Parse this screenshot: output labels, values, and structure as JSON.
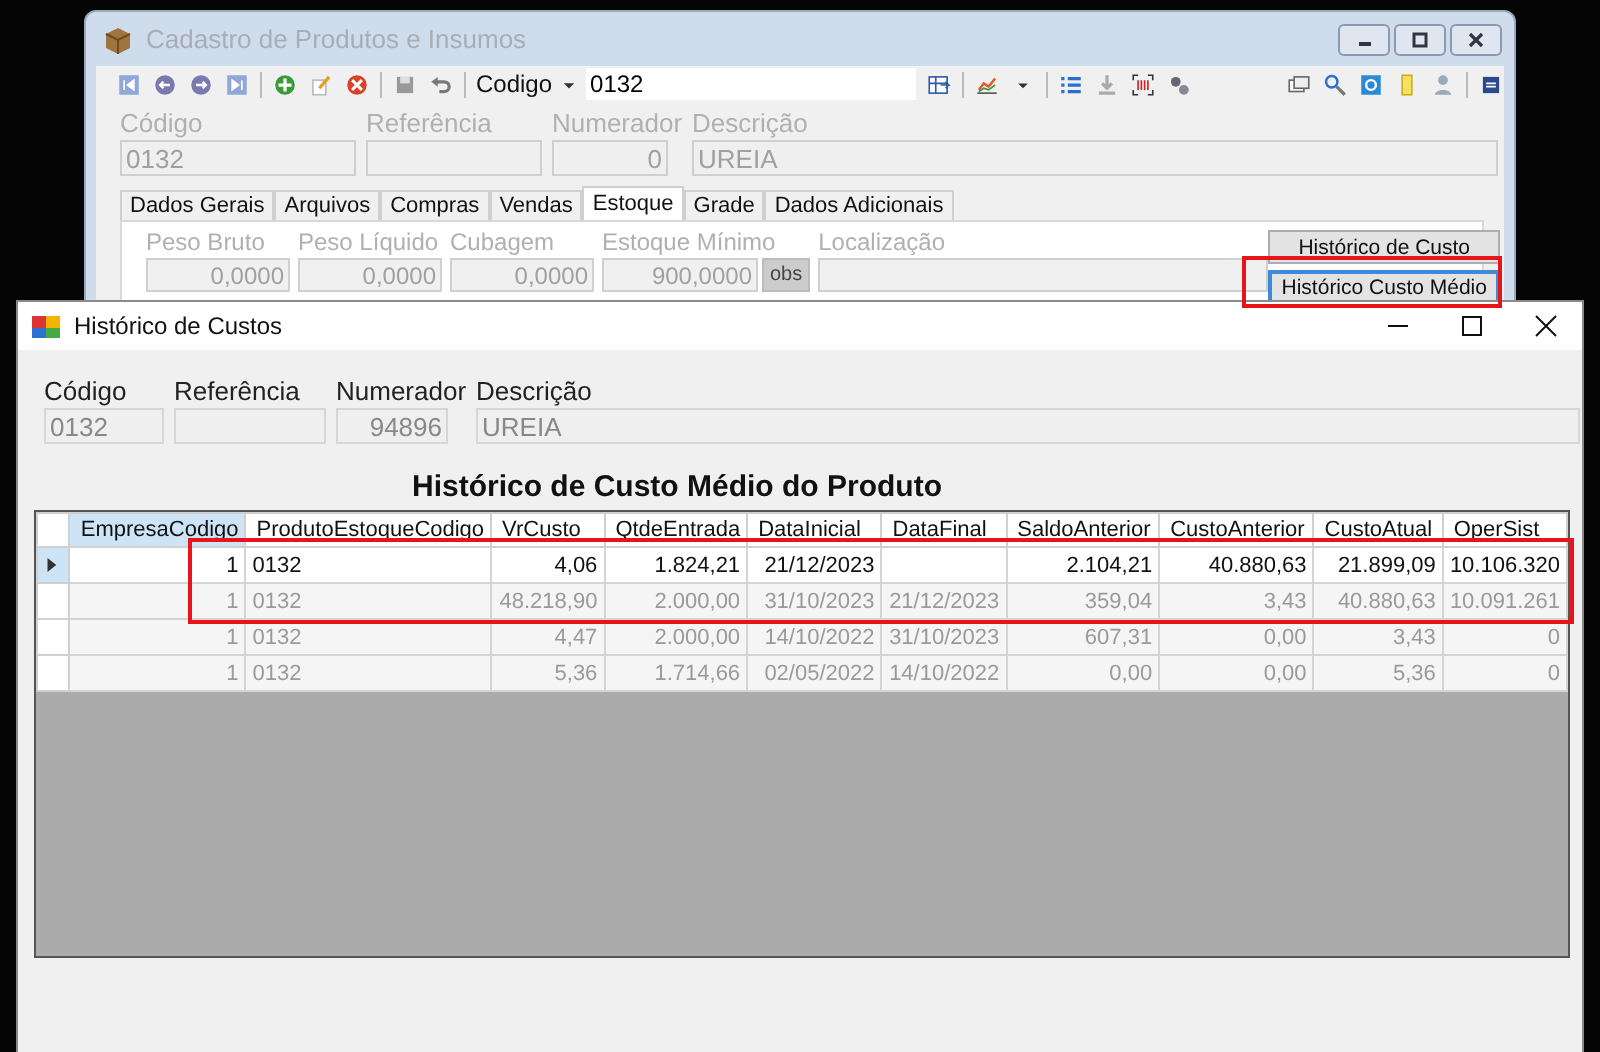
{
  "back_window": {
    "title": "Cadastro de Produtos e Insumos",
    "toolbar": {
      "search_field_label": "Codigo",
      "search_value": "0132"
    },
    "header_fields": [
      {
        "label": "Código",
        "value": "0132",
        "kind": "text"
      },
      {
        "label": "Referência",
        "kind": "text"
      },
      {
        "label": "Numerador",
        "value": "0",
        "kind": "number"
      },
      {
        "label": "Descrição",
        "value": "UREIA",
        "kind": "text"
      }
    ],
    "tabs": [
      {
        "label": "Dados Gerais",
        "selected": false
      },
      {
        "label": "Arquivos",
        "selected": false
      },
      {
        "label": "Compras",
        "selected": false
      },
      {
        "label": "Vendas",
        "selected": false
      },
      {
        "label": "Estoque",
        "selected": true
      },
      {
        "label": "Grade",
        "selected": false
      },
      {
        "label": "Dados Adicionais",
        "selected": false
      }
    ],
    "stock_fields": [
      {
        "label": "Peso Bruto",
        "value": "0,0000"
      },
      {
        "label": "Peso Líquido",
        "value": "0,0000"
      },
      {
        "label": "Cubagem",
        "value": "0,0000"
      },
      {
        "label": "Estoque Mínimo",
        "value": "900,0000",
        "button": "obs"
      },
      {
        "label": "Localização"
      }
    ],
    "buttons": [
      {
        "label": "Histórico de Custo",
        "focused": false
      },
      {
        "label": "Histórico Custo Médio",
        "focused": true
      }
    ]
  },
  "dialog": {
    "title": "Histórico de Custos",
    "fields": [
      {
        "label": "Código",
        "value": "0132",
        "kind": "text"
      },
      {
        "label": "Referência",
        "kind": "text"
      },
      {
        "label": "Numerador",
        "value": "94896",
        "kind": "number"
      },
      {
        "label": "Descrição",
        "value": "UREIA",
        "kind": "text"
      }
    ],
    "heading": "Histórico de Custo Médio do Produto",
    "table": {
      "columns": [
        {
          "label": "EmpresaCodigo",
          "selected": true
        },
        {
          "label": "ProdutoEstoqueCodigo",
          "selected": false
        },
        {
          "label": "VrCusto",
          "selected": false
        },
        {
          "label": "QtdeEntrada",
          "selected": false
        },
        {
          "label": "DataInicial",
          "selected": false
        },
        {
          "label": "DataFinal",
          "selected": false
        },
        {
          "label": "SaldoAnterior",
          "selected": false
        },
        {
          "label": "CustoAnterior",
          "selected": false
        },
        {
          "label": "CustoAtual",
          "selected": false
        },
        {
          "label": "OperSist",
          "selected": false
        }
      ],
      "rows": [
        {
          "selected": true,
          "cells": [
            "1",
            "0132",
            "4,06",
            "1.824,21",
            "21/12/2023",
            "",
            "2.104,21",
            "40.880,63",
            "21.899,09",
            "10.106.320"
          ]
        },
        {
          "selected": false,
          "cells": [
            "1",
            "0132",
            "48.218,90",
            "2.000,00",
            "31/10/2023",
            "21/12/2023",
            "359,04",
            "3,43",
            "40.880,63",
            "10.091.261"
          ]
        },
        {
          "selected": false,
          "cells": [
            "1",
            "0132",
            "4,47",
            "2.000,00",
            "14/10/2022",
            "31/10/2023",
            "607,31",
            "0,00",
            "3,43",
            "0"
          ]
        },
        {
          "selected": false,
          "cells": [
            "1",
            "0132",
            "5,36",
            "1.714,66",
            "02/05/2022",
            "14/10/2022",
            "0,00",
            "0,00",
            "5,36",
            "0"
          ]
        }
      ]
    }
  }
}
